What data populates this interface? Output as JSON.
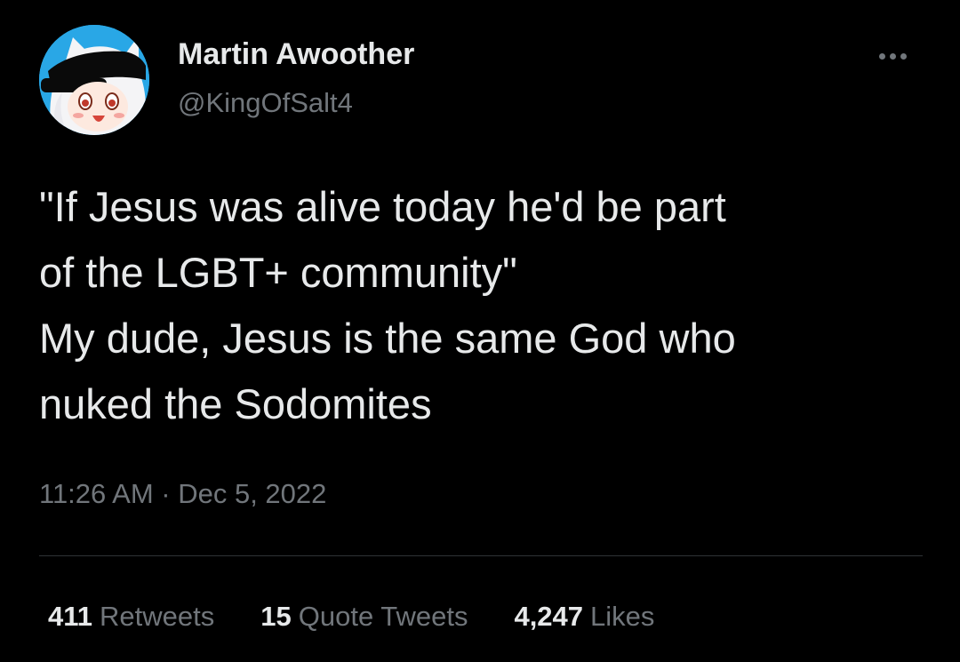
{
  "author": {
    "display_name": "Martin Awoother",
    "handle": "@KingOfSalt4"
  },
  "tweet": {
    "lines": [
      "\"If Jesus was alive today he'd be part",
      "of the LGBT+ community\"",
      "My dude, Jesus is the same God who",
      "nuked the Sodomites"
    ],
    "timestamp": "11:26 AM · Dec 5, 2022"
  },
  "stats": {
    "retweets": {
      "count": "411",
      "label": "Retweets"
    },
    "quote_tweets": {
      "count": "15",
      "label": "Quote Tweets"
    },
    "likes": {
      "count": "4,247",
      "label": "Likes"
    }
  },
  "icons": {
    "more": "more-options-icon",
    "avatar": "anime-avatar"
  },
  "colors": {
    "background": "#000000",
    "primary_text": "#e7e9ea",
    "secondary_text": "#71767b",
    "divider": "#2f3336",
    "avatar_bg": "#29a7e6"
  }
}
